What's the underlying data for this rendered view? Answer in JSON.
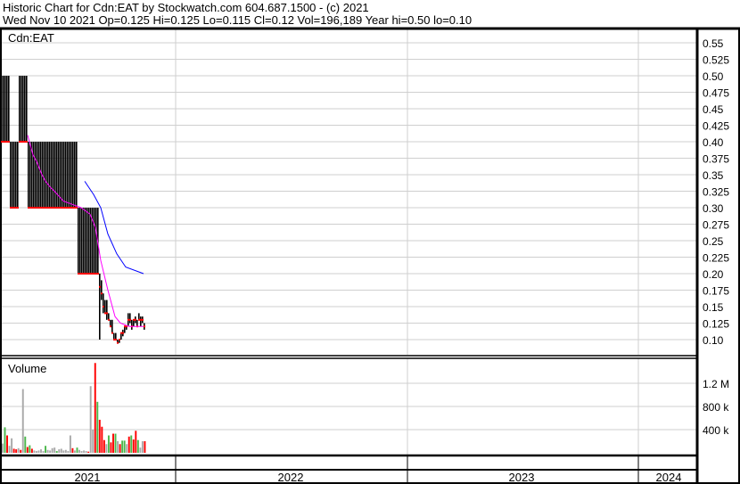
{
  "header": {
    "title": "Historic Chart for Cdn:EAT by Stockwatch.com 604.687.1500 - (c) 2021",
    "quote": "Wed Nov 10 2021  Op=0.125  Hi=0.125  Lo=0.115  Cl=0.12  Vol=196,189  Year hi=0.50  lo=0.10"
  },
  "chart_data": {
    "type": "bar",
    "title": "Cdn:EAT",
    "volume_label": "Volume",
    "price_ticks": [
      "0.55",
      "0.525",
      "0.50",
      "0.475",
      "0.45",
      "0.425",
      "0.40",
      "0.375",
      "0.35",
      "0.325",
      "0.30",
      "0.275",
      "0.25",
      "0.225",
      "0.20",
      "0.175",
      "0.15",
      "0.125",
      "0.10"
    ],
    "price_tick_values": [
      0.55,
      0.525,
      0.5,
      0.475,
      0.45,
      0.425,
      0.4,
      0.375,
      0.35,
      0.325,
      0.3,
      0.275,
      0.25,
      0.225,
      0.2,
      0.175,
      0.15,
      0.125,
      0.1
    ],
    "ylim": [
      0.09,
      0.57
    ],
    "volume_ticks": [
      {
        "label": "1.2 M",
        "value": 1200
      },
      {
        "label": "800 k",
        "value": 800
      },
      {
        "label": "400 k",
        "value": 400
      }
    ],
    "years": [
      "2021",
      "2022",
      "2023",
      "2024"
    ],
    "colors": {
      "bar": "#000000",
      "close": "#ff0000",
      "ma_short": "#ff00ff",
      "ma_long": "#0000ff",
      "vol_up": "#4cb84c",
      "vol_down": "#ff0000",
      "vol_flat": "#a9a9a9"
    },
    "bars": [
      [
        0.5,
        0.4,
        0.4
      ],
      [
        0.5,
        0.4,
        0.4
      ],
      [
        0.5,
        0.4,
        0.4
      ],
      [
        0.5,
        0.4,
        0.4
      ],
      [
        0.5,
        0.4,
        0.4
      ],
      [
        0.4,
        0.3,
        0.3
      ],
      [
        0.4,
        0.3,
        0.3
      ],
      [
        0.4,
        0.3,
        0.3
      ],
      [
        0.4,
        0.3,
        0.3
      ],
      [
        0.4,
        0.3,
        0.3
      ],
      [
        0.5,
        0.4,
        0.4
      ],
      [
        0.5,
        0.4,
        0.4
      ],
      [
        0.5,
        0.4,
        0.4
      ],
      [
        0.5,
        0.4,
        0.4
      ],
      [
        0.5,
        0.4,
        0.4
      ],
      [
        0.4,
        0.3,
        0.3
      ],
      [
        0.4,
        0.3,
        0.3
      ],
      [
        0.4,
        0.3,
        0.3
      ],
      [
        0.4,
        0.3,
        0.3
      ],
      [
        0.4,
        0.3,
        0.3
      ],
      [
        0.4,
        0.3,
        0.3
      ],
      [
        0.4,
        0.3,
        0.3
      ],
      [
        0.4,
        0.3,
        0.3
      ],
      [
        0.4,
        0.3,
        0.3
      ],
      [
        0.4,
        0.3,
        0.3
      ],
      [
        0.4,
        0.3,
        0.3
      ],
      [
        0.4,
        0.3,
        0.3
      ],
      [
        0.4,
        0.3,
        0.3
      ],
      [
        0.4,
        0.3,
        0.3
      ],
      [
        0.4,
        0.3,
        0.3
      ],
      [
        0.4,
        0.3,
        0.3
      ],
      [
        0.4,
        0.3,
        0.3
      ],
      [
        0.4,
        0.3,
        0.3
      ],
      [
        0.4,
        0.3,
        0.3
      ],
      [
        0.4,
        0.3,
        0.3
      ],
      [
        0.4,
        0.3,
        0.3
      ],
      [
        0.4,
        0.3,
        0.3
      ],
      [
        0.4,
        0.3,
        0.3
      ],
      [
        0.4,
        0.3,
        0.3
      ],
      [
        0.4,
        0.3,
        0.3
      ],
      [
        0.4,
        0.3,
        0.3
      ],
      [
        0.4,
        0.3,
        0.3
      ],
      [
        0.4,
        0.3,
        0.3
      ],
      [
        0.3,
        0.2,
        0.2
      ],
      [
        0.3,
        0.2,
        0.2
      ],
      [
        0.3,
        0.2,
        0.2
      ],
      [
        0.3,
        0.2,
        0.2
      ],
      [
        0.3,
        0.2,
        0.2
      ],
      [
        0.3,
        0.2,
        0.2
      ],
      [
        0.3,
        0.2,
        0.2
      ],
      [
        0.3,
        0.2,
        0.2
      ],
      [
        0.3,
        0.2,
        0.2
      ],
      [
        0.3,
        0.2,
        0.2
      ],
      [
        0.3,
        0.2,
        0.2
      ],
      [
        0.3,
        0.2,
        0.2
      ],
      [
        0.2,
        0.1,
        0.18
      ],
      [
        0.19,
        0.16,
        0.17
      ],
      [
        0.17,
        0.14,
        0.15
      ],
      [
        0.16,
        0.14,
        0.14
      ],
      [
        0.16,
        0.13,
        0.14
      ],
      [
        0.14,
        0.13,
        0.13
      ],
      [
        0.13,
        0.12,
        0.12
      ],
      [
        0.13,
        0.11,
        0.11
      ],
      [
        0.11,
        0.1,
        0.1
      ],
      [
        0.11,
        0.1,
        0.1
      ],
      [
        0.1,
        0.095,
        0.095
      ],
      [
        0.1,
        0.095,
        0.1
      ],
      [
        0.11,
        0.1,
        0.11
      ],
      [
        0.115,
        0.105,
        0.11
      ],
      [
        0.12,
        0.11,
        0.12
      ],
      [
        0.12,
        0.115,
        0.12
      ],
      [
        0.14,
        0.12,
        0.13
      ],
      [
        0.14,
        0.125,
        0.13
      ],
      [
        0.13,
        0.115,
        0.12
      ],
      [
        0.13,
        0.12,
        0.13
      ],
      [
        0.135,
        0.125,
        0.13
      ],
      [
        0.13,
        0.12,
        0.12
      ],
      [
        0.14,
        0.13,
        0.13
      ],
      [
        0.135,
        0.12,
        0.13
      ],
      [
        0.135,
        0.125,
        0.13
      ],
      [
        0.125,
        0.115,
        0.12
      ]
    ],
    "ma_short": [
      [
        15,
        0.41
      ],
      [
        18,
        0.38
      ],
      [
        20,
        0.37
      ],
      [
        23,
        0.35
      ],
      [
        25,
        0.34
      ],
      [
        28,
        0.33
      ],
      [
        30,
        0.325
      ],
      [
        35,
        0.31
      ],
      [
        40,
        0.305
      ],
      [
        45,
        0.3
      ],
      [
        50,
        0.29
      ],
      [
        53,
        0.27
      ],
      [
        56,
        0.22
      ],
      [
        60,
        0.175
      ],
      [
        64,
        0.135
      ],
      [
        67,
        0.125
      ],
      [
        72,
        0.12
      ],
      [
        80,
        0.12
      ]
    ],
    "ma_long": [
      [
        47,
        0.34
      ],
      [
        52,
        0.32
      ],
      [
        56,
        0.3
      ],
      [
        60,
        0.26
      ],
      [
        65,
        0.23
      ],
      [
        70,
        0.21
      ],
      [
        80,
        0.2
      ]
    ],
    "volume": [
      [
        160,
        "n"
      ],
      [
        440,
        "g"
      ],
      [
        300,
        "r"
      ],
      [
        120,
        "n"
      ],
      [
        250,
        "n"
      ],
      [
        70,
        "r"
      ],
      [
        60,
        "r"
      ],
      [
        80,
        "n"
      ],
      [
        50,
        "r"
      ],
      [
        1100,
        "n"
      ],
      [
        280,
        "g"
      ],
      [
        100,
        "r"
      ],
      [
        130,
        "g"
      ],
      [
        70,
        "r"
      ],
      [
        40,
        "n"
      ],
      [
        30,
        "n"
      ],
      [
        40,
        "n"
      ],
      [
        60,
        "n"
      ],
      [
        30,
        "n"
      ],
      [
        120,
        "g"
      ],
      [
        50,
        "n"
      ],
      [
        40,
        "n"
      ],
      [
        80,
        "n"
      ],
      [
        90,
        "n"
      ],
      [
        30,
        "g"
      ],
      [
        60,
        "n"
      ],
      [
        70,
        "n"
      ],
      [
        40,
        "n"
      ],
      [
        50,
        "n"
      ],
      [
        30,
        "n"
      ],
      [
        300,
        "n"
      ],
      [
        80,
        "r"
      ],
      [
        40,
        "n"
      ],
      [
        90,
        "g"
      ],
      [
        50,
        "n"
      ],
      [
        30,
        "n"
      ],
      [
        40,
        "n"
      ],
      [
        30,
        "n"
      ],
      [
        20,
        "r"
      ],
      [
        1150,
        "n"
      ],
      [
        400,
        "n"
      ],
      [
        1550,
        "r"
      ],
      [
        880,
        "g"
      ],
      [
        570,
        "r"
      ],
      [
        450,
        "r"
      ],
      [
        220,
        "r"
      ],
      [
        150,
        "n"
      ],
      [
        300,
        "g"
      ],
      [
        180,
        "r"
      ],
      [
        330,
        "r"
      ],
      [
        330,
        "g"
      ],
      [
        200,
        "n"
      ],
      [
        150,
        "r"
      ],
      [
        210,
        "g"
      ],
      [
        210,
        "g"
      ],
      [
        150,
        "n"
      ],
      [
        280,
        "r"
      ],
      [
        300,
        "g"
      ],
      [
        230,
        "r"
      ],
      [
        380,
        "r"
      ],
      [
        220,
        "g"
      ],
      [
        90,
        "n"
      ],
      [
        200,
        "n"
      ],
      [
        200,
        "r"
      ]
    ]
  }
}
